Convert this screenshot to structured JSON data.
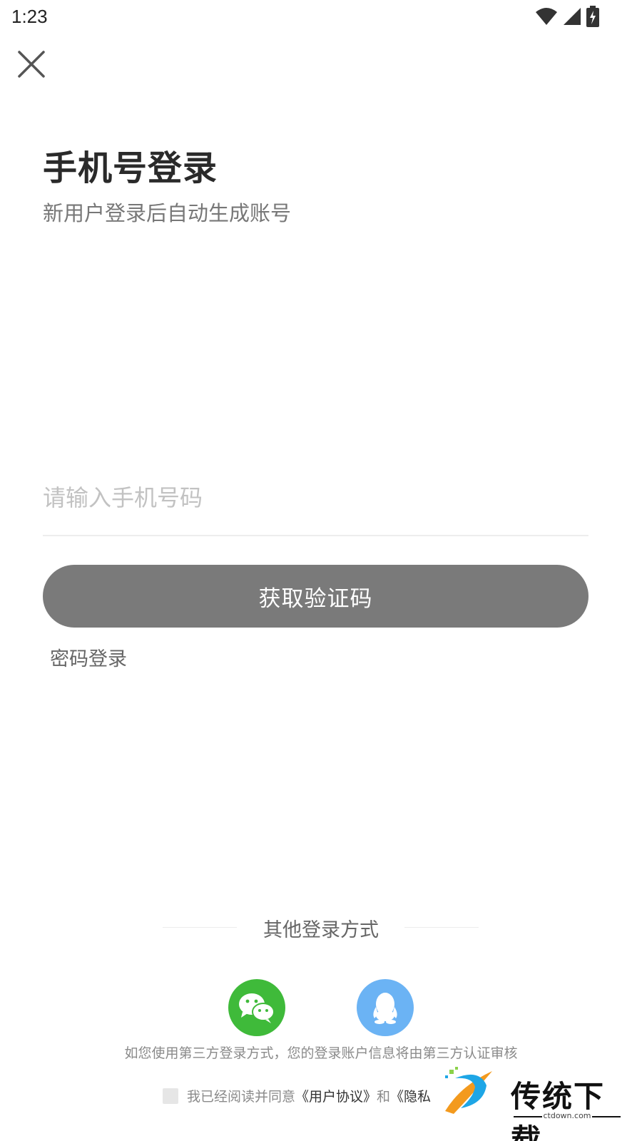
{
  "status_bar": {
    "time": "1:23"
  },
  "icons": {
    "close": "close-icon",
    "wifi": "wifi-icon",
    "signal": "signal-icon",
    "battery": "battery-charging-icon",
    "wechat": "wechat-icon",
    "qq": "qq-icon"
  },
  "header": {
    "title": "手机号登录",
    "subtitle": "新用户登录后自动生成账号"
  },
  "form": {
    "phone_placeholder": "请输入手机号码",
    "phone_value": "",
    "get_code_label": "获取验证码",
    "password_login_label": "密码登录"
  },
  "other_login": {
    "label": "其他登录方式"
  },
  "footer": {
    "third_party_note": "如您使用第三方登录方式，您的登录账户信息将由第三方认证审核",
    "agree_prefix": "我已经阅读并同意",
    "user_agreement": "《用户协议》",
    "and": "和",
    "privacy_partial": "《隐私"
  },
  "watermark": {
    "text": "传统下载",
    "url": "ctdown.com"
  },
  "colors": {
    "button_bg": "#7a7a7a",
    "wechat_green": "#3fba3a",
    "qq_blue": "#6bb3f4"
  }
}
